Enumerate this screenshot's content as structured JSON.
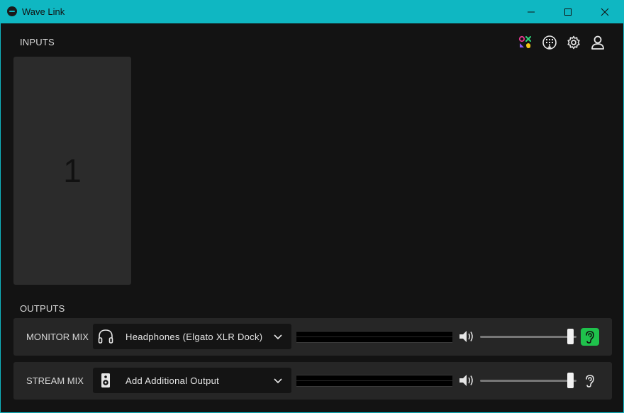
{
  "window": {
    "title": "Wave Link",
    "accent": "#0fb7c2"
  },
  "toolbar": {
    "icons": [
      "marketplace-icon",
      "streamdeck-icon",
      "settings-icon",
      "account-icon"
    ]
  },
  "inputs": {
    "label": "INPUTS",
    "channels": [
      {
        "number": "1"
      }
    ]
  },
  "outputs": {
    "label": "OUTPUTS",
    "rows": [
      {
        "label": "MONITOR MIX",
        "device": "Headphones (Elgato XLR Dock)",
        "device_icon": "headphones-icon",
        "volume": 0.97,
        "monitoring": true
      },
      {
        "label": "STREAM MIX",
        "device": "Add Additional Output",
        "device_icon": "speaker-icon",
        "volume": 0.97,
        "monitoring": false
      }
    ]
  },
  "colors": {
    "monitor_active": "#1fc24c"
  }
}
